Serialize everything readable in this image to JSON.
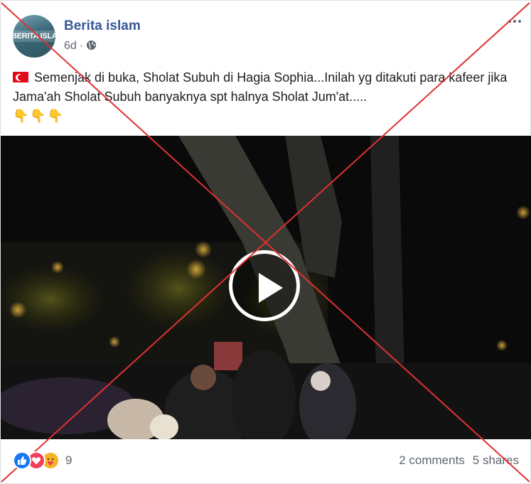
{
  "post": {
    "page_name": "Berita islam",
    "avatar_text": "BERITA ISLAM",
    "time": "6d",
    "separator": "·",
    "privacy_icon": "globe-icon",
    "menu_icon": "more-icon",
    "text": "Semenjak di buka, Sholat Subuh di Hagia Sophia...Inilah yg ditakuti para kafeer jika Jama'ah Sholat Subuh banyaknya spt halnya Sholat Jum'at.....",
    "text_prefix_icon": "turkey-flag-icon",
    "text_suffix_emoji": [
      "👇",
      "👇",
      "👇"
    ],
    "video": {
      "play_icon": "play-icon",
      "description": ""
    }
  },
  "footer": {
    "reactions": [
      {
        "name": "like-reaction-icon",
        "color": "#1877f2"
      },
      {
        "name": "love-reaction-icon",
        "color": "#f33e58"
      },
      {
        "name": "care-reaction-icon",
        "color": "#f7b125"
      }
    ],
    "reaction_count": "9",
    "comments": "2 comments",
    "shares": "5 shares"
  },
  "overlay": {
    "mark": "x-cross-mark",
    "color": "#e03131"
  },
  "colors": {
    "link_blue": "#385898",
    "secondary_text": "#606770",
    "border": "#dddfe2"
  }
}
